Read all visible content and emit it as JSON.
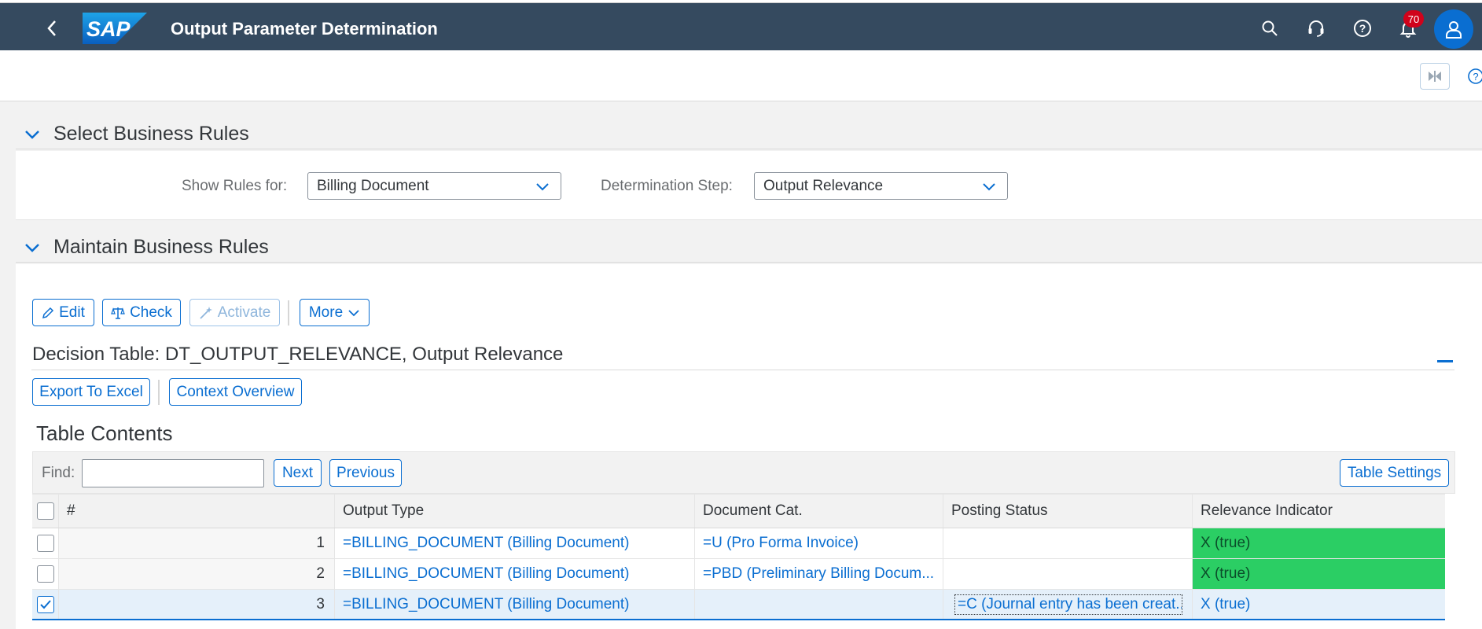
{
  "shell": {
    "title": "Output Parameter Determination",
    "logo_text": "SAP",
    "notification_count": "70",
    "colors": {
      "shell_bg": "#354a5f",
      "accent": "#0a6ed1",
      "badge": "#d0021b"
    }
  },
  "sections": {
    "select_rules": {
      "title": "Select Business Rules",
      "show_rules_label": "Show Rules for:",
      "show_rules_value": "Billing Document",
      "determination_step_label": "Determination Step:",
      "determination_step_value": "Output Relevance"
    },
    "maintain_rules": {
      "title": "Maintain Business Rules",
      "toolbar": {
        "edit": "Edit",
        "check": "Check",
        "activate": "Activate",
        "more": "More"
      },
      "decision_table_title": "Decision Table: DT_OUTPUT_RELEVANCE, Output Relevance",
      "export_label": "Export To Excel",
      "context_overview_label": "Context Overview",
      "table_contents_title": "Table Contents",
      "find_label": "Find:",
      "find_value": "",
      "next_label": "Next",
      "previous_label": "Previous",
      "table_settings_label": "Table Settings"
    }
  },
  "table": {
    "columns": [
      "#",
      "Output Type",
      "Document Cat.",
      "Posting Status",
      "Relevance Indicator"
    ],
    "rows": [
      {
        "num": "1",
        "output_type": "=BILLING_DOCUMENT (Billing Document)",
        "doc_cat": "=U (Pro Forma Invoice)",
        "posting_status": "",
        "relevance": "X (true)",
        "checked": false
      },
      {
        "num": "2",
        "output_type": "=BILLING_DOCUMENT (Billing Document)",
        "doc_cat": "=PBD (Preliminary Billing Docum...",
        "posting_status": "",
        "relevance": "X (true)",
        "checked": false
      },
      {
        "num": "3",
        "output_type": "=BILLING_DOCUMENT (Billing Document)",
        "doc_cat": "",
        "posting_status": "=C (Journal entry has been creat...",
        "relevance": "X (true)",
        "checked": true
      }
    ],
    "colors": {
      "relevance_true": "#2bce64",
      "selected_row": "#e5f0fa"
    }
  }
}
